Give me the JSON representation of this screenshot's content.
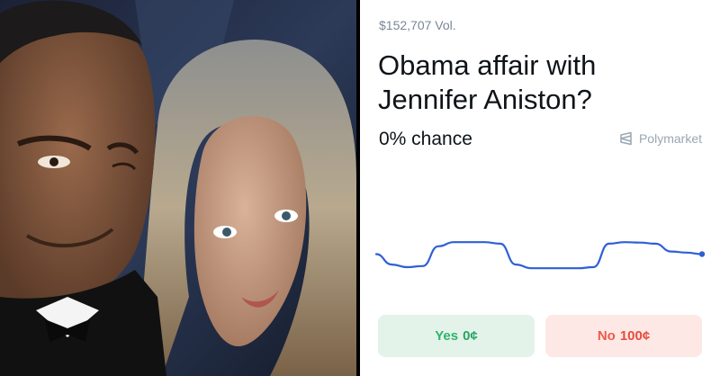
{
  "photo": {
    "icon": "photo-icon"
  },
  "market": {
    "volume": "$152,707 Vol.",
    "question": "Obama affair with Jennifer Aniston?",
    "chance": "0% chance",
    "brand": "Polymarket",
    "brand_icon": "polymarket-logo-icon",
    "yes_label": "Yes",
    "yes_price": "0¢",
    "no_label": "No",
    "no_price": "100¢",
    "colors": {
      "line": "#2f5fd6",
      "yes": "#2fb36b",
      "no": "#ef5a4a"
    }
  },
  "chart_data": {
    "type": "line",
    "title": "",
    "xlabel": "",
    "ylabel": "",
    "ylim": [
      0,
      1
    ],
    "grid": false,
    "series": [
      {
        "values": [
          0.75,
          0.55,
          0.5,
          0.52,
          0.9,
          0.98,
          0.98,
          0.98,
          0.95,
          0.55,
          0.48,
          0.48,
          0.48,
          0.48,
          0.5,
          0.95,
          0.98,
          0.97,
          0.95,
          0.8,
          0.78,
          0.75
        ]
      }
    ]
  }
}
